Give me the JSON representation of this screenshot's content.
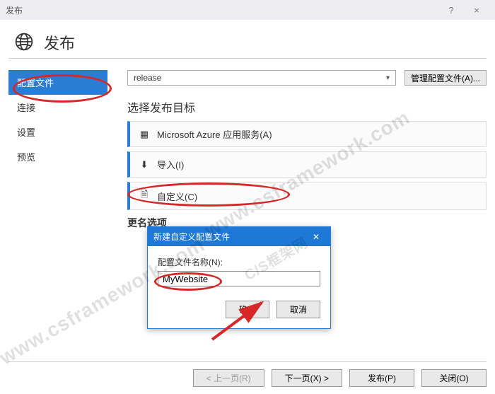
{
  "titlebar": {
    "title": "发布",
    "help": "?",
    "close": "×"
  },
  "header": {
    "title": "发布"
  },
  "sidebar": {
    "items": [
      {
        "label": "配置文件",
        "active": true
      },
      {
        "label": "连接"
      },
      {
        "label": "设置"
      },
      {
        "label": "预览"
      }
    ]
  },
  "content": {
    "profile_select": "release",
    "manage_profiles": "管理配置文件(A)...",
    "section_title": "选择发布目标",
    "targets": [
      {
        "icon": "azure",
        "label": "Microsoft Azure 应用服务(A)"
      },
      {
        "icon": "import",
        "label": "导入(I)"
      },
      {
        "icon": "custom",
        "label": "自定义(C)"
      }
    ],
    "rename_trunc": "更名选项"
  },
  "modal": {
    "title": "新建自定义配置文件",
    "label": "配置文件名称(N):",
    "value": "MyWebsite",
    "ok": "确定",
    "cancel": "取消"
  },
  "footer": {
    "prev": "< 上一页(R)",
    "next": "下一页(X) >",
    "publish": "发布(P)",
    "close": "关闭(O)"
  },
  "watermark": {
    "url": "www.csframework.com",
    "brand": "C/S框架网"
  }
}
